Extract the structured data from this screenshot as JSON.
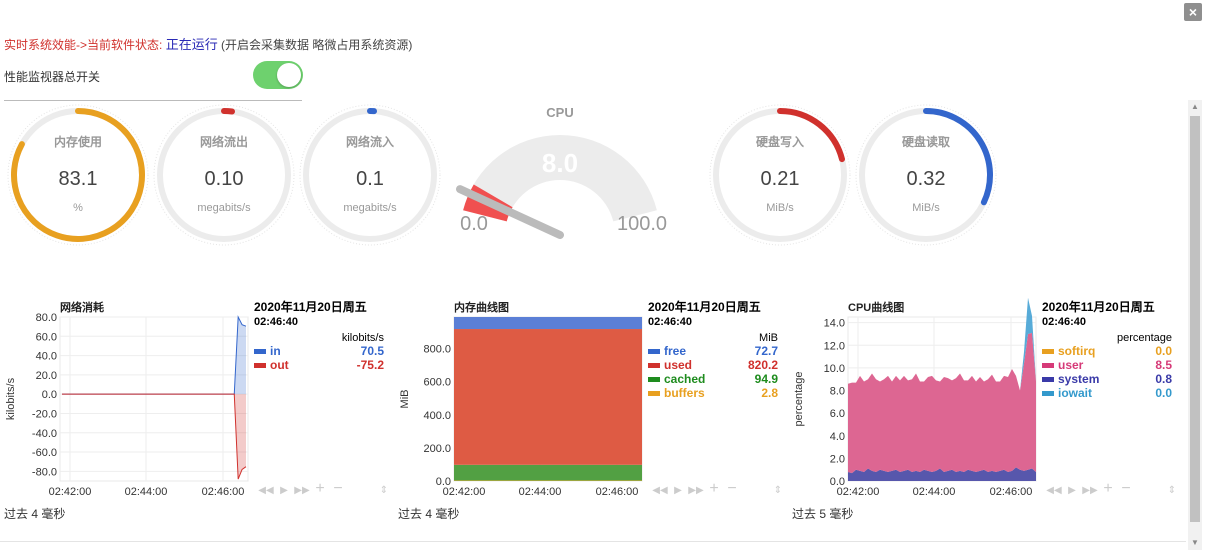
{
  "window": {
    "close_label": "×"
  },
  "status": {
    "prefix": "实时系统效能->当前软件状态:",
    "value": "正在运行",
    "note": "(开启会采集数据 略微占用系统资源)"
  },
  "master_switch": {
    "label": "性能监视器总开关",
    "on": true
  },
  "gauges": [
    {
      "id": "mem",
      "title": "内存使用",
      "value": "83.1",
      "units": "%",
      "fraction": 0.83,
      "color": "#e8a020"
    },
    {
      "id": "netout",
      "title": "网络流出",
      "value": "0.10",
      "units": "megabits/s",
      "fraction": 0.02,
      "color": "#d0312d"
    },
    {
      "id": "netin",
      "title": "网络流入",
      "value": "0.1",
      "units": "megabits/s",
      "fraction": 0.005,
      "color": "#3366cc"
    },
    {
      "id": "diskw",
      "title": "硬盘写入",
      "value": "0.21",
      "units": "MiB/s",
      "fraction": 0.21,
      "color": "#d0312d"
    },
    {
      "id": "diskr",
      "title": "硬盘读取",
      "value": "0.32",
      "units": "MiB/s",
      "fraction": 0.32,
      "color": "#3366cc"
    }
  ],
  "cpu_gauge": {
    "title": "CPU",
    "value": "8.0",
    "min": "0.0",
    "max": "100.0",
    "fraction": 0.08
  },
  "chart_data": [
    {
      "type": "line",
      "title": "网络消耗",
      "ylabel": "kilobits/s",
      "xlabel": "",
      "ylim": [
        -90,
        80
      ],
      "yticks": [
        "80.0",
        "60.0",
        "40.0",
        "20.0",
        "0.0",
        "-20.0",
        "-40.0",
        "-60.0",
        "-80.0"
      ],
      "xticks": [
        "02:42:00",
        "02:44:00",
        "02:46:00"
      ],
      "legend": {
        "date": "2020年11月20日周五",
        "time": "02:46:40",
        "units": "kilobits/s",
        "items": [
          {
            "name": "in",
            "value": "70.5",
            "color": "#3366cc"
          },
          {
            "name": "out",
            "value": "-75.2",
            "color": "#d0312d"
          }
        ]
      },
      "series": [
        {
          "name": "in",
          "values": [
            0,
            0,
            0,
            0,
            0,
            0,
            0,
            0,
            0,
            0,
            0,
            0,
            0,
            0,
            0,
            0,
            0,
            0,
            0,
            0,
            0,
            0,
            0,
            0,
            0,
            0,
            0,
            0,
            0,
            0,
            0,
            0,
            0,
            0,
            0,
            0,
            0,
            0,
            0,
            0,
            0,
            0,
            0,
            0,
            0,
            80,
            72,
            70.5
          ]
        },
        {
          "name": "out",
          "values": [
            0,
            0,
            0,
            0,
            0,
            0,
            0,
            0,
            0,
            0,
            0,
            0,
            0,
            0,
            0,
            0,
            0,
            0,
            0,
            0,
            0,
            0,
            0,
            0,
            0,
            0,
            0,
            0,
            0,
            0,
            0,
            0,
            0,
            0,
            0,
            0,
            0,
            0,
            0,
            0,
            0,
            0,
            0,
            0,
            0,
            -88,
            -78,
            -75.2
          ]
        }
      ],
      "footer": "过去 4 毫秒"
    },
    {
      "type": "area",
      "title": "内存曲线图",
      "ylabel": "MiB",
      "xlabel": "",
      "ylim": [
        0,
        990.6
      ],
      "yticks": [
        "800.0",
        "600.0",
        "400.0",
        "200.0",
        "0.0"
      ],
      "xticks": [
        "02:42:00",
        "02:44:00",
        "02:46:00"
      ],
      "legend": {
        "date": "2020年11月20日周五",
        "time": "02:46:40",
        "units": "MiB",
        "items": [
          {
            "name": "free",
            "value": "72.7",
            "color": "#3366cc"
          },
          {
            "name": "used",
            "value": "820.2",
            "color": "#d0312d"
          },
          {
            "name": "cached",
            "value": "94.9",
            "color": "#1e8c1e"
          },
          {
            "name": "buffers",
            "value": "2.8",
            "color": "#e8a020"
          }
        ]
      },
      "stack": [
        {
          "name": "buffers",
          "value": 2.8,
          "color": "#f0a830"
        },
        {
          "name": "cached",
          "value": 94.9,
          "color": "#52a043"
        },
        {
          "name": "used",
          "value": 820.2,
          "color": "#de5b44"
        },
        {
          "name": "free",
          "value": 72.7,
          "color": "#5b7fd6"
        }
      ],
      "footer": "过去 4 毫秒"
    },
    {
      "type": "area",
      "title": "CPU曲线图",
      "ylabel": "percentage",
      "xlabel": "",
      "ylim": [
        0,
        14.5
      ],
      "yticks": [
        "14.0",
        "12.0",
        "10.0",
        "8.0",
        "6.0",
        "4.0",
        "2.0",
        "0.0"
      ],
      "xticks": [
        "02:42:00",
        "02:44:00",
        "02:46:00"
      ],
      "legend": {
        "date": "2020年11月20日周五",
        "time": "02:46:40",
        "units": "percentage",
        "items": [
          {
            "name": "softirq",
            "value": "0.0",
            "color": "#e8a020"
          },
          {
            "name": "user",
            "value": "8.5",
            "color": "#d63a78"
          },
          {
            "name": "system",
            "value": "0.8",
            "color": "#3a3aa8"
          },
          {
            "name": "iowait",
            "value": "0.0",
            "color": "#3399cc"
          }
        ]
      },
      "series": [
        {
          "name": "system",
          "values": [
            0.8,
            0.7,
            1.0,
            0.9,
            0.8,
            1.1,
            0.9,
            0.8,
            1.0,
            0.9,
            0.8,
            0.9,
            1.0,
            0.8,
            0.9,
            1.0,
            0.8,
            0.9,
            0.8,
            1.0,
            0.9,
            0.8,
            0.9,
            1.1,
            0.8,
            0.9,
            1.0,
            0.8,
            0.9,
            0.8,
            1.0,
            0.9,
            0.8,
            0.9,
            1.0,
            0.8,
            0.9,
            0.8,
            0.9,
            1.0,
            0.8,
            0.9,
            1.2,
            1.0,
            0.9,
            1.0,
            1.1,
            0.8
          ]
        },
        {
          "name": "user",
          "values": [
            7.8,
            8.0,
            7.7,
            8.4,
            8.0,
            7.9,
            8.6,
            8.2,
            7.8,
            8.1,
            8.5,
            7.9,
            8.3,
            8.1,
            8.4,
            7.9,
            8.2,
            8.6,
            8.0,
            7.8,
            8.3,
            8.5,
            8.0,
            7.7,
            8.4,
            8.2,
            7.9,
            8.3,
            8.6,
            8.1,
            7.9,
            8.4,
            8.0,
            8.3,
            7.8,
            8.2,
            8.5,
            8.0,
            7.9,
            8.3,
            8.4,
            9.0,
            8.1,
            7.0,
            9.5,
            12.0,
            12.0,
            8.0
          ]
        },
        {
          "name": "iowait",
          "values": [
            0,
            0,
            0,
            0,
            0,
            0,
            0,
            0,
            0,
            0,
            0,
            0,
            0,
            0,
            0,
            0,
            0,
            0,
            0,
            0,
            0,
            0,
            0,
            0,
            0,
            0,
            0,
            0,
            0,
            0,
            0,
            0,
            0,
            0,
            0,
            0,
            0,
            0,
            0,
            0,
            0,
            0,
            0,
            0,
            1.0,
            3.2,
            1.5,
            0
          ]
        }
      ],
      "footer": "过去 5 毫秒"
    }
  ]
}
